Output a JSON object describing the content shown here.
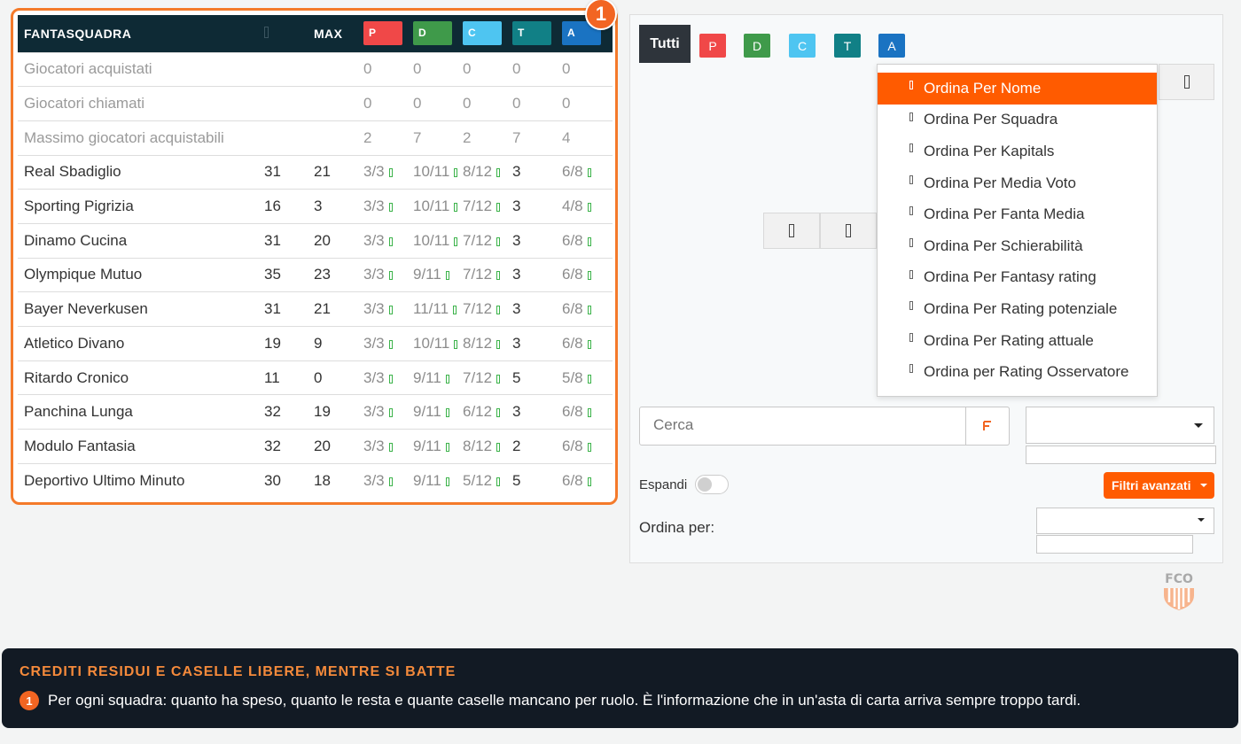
{
  "colors": {
    "accent": "#ff5b00",
    "p": "#f04848",
    "d": "#3f9a4a",
    "c": "#4ec5f1",
    "t": "#118086",
    "a": "#1a73c2",
    "ok": "#3cb34a"
  },
  "table": {
    "badge": "1",
    "headers": {
      "team": "FANTASQUADRA",
      "max": "MAX",
      "p": "P",
      "d": "D",
      "c": "C",
      "t": "T",
      "a": "A"
    },
    "summary": [
      {
        "label": "Giocatori acquistati",
        "p": "0",
        "d": "0",
        "c": "0",
        "t": "0",
        "a": "0"
      },
      {
        "label": "Giocatori chiamati",
        "p": "0",
        "d": "0",
        "c": "0",
        "t": "0",
        "a": "0"
      },
      {
        "label": "Massimo giocatori acquistabili",
        "p": "2",
        "d": "7",
        "c": "2",
        "t": "7",
        "a": "4"
      }
    ],
    "rows": [
      {
        "team": "Real Sbadiglio",
        "credits": "31",
        "max": "21",
        "p": "3/3",
        "d": "10/11",
        "c": "8/12",
        "t": "3",
        "a": "6/8"
      },
      {
        "team": "Sporting Pigrizia",
        "credits": "16",
        "max": "3",
        "p": "3/3",
        "d": "10/11",
        "c": "7/12",
        "t": "3",
        "a": "4/8"
      },
      {
        "team": "Dinamo Cucina",
        "credits": "31",
        "max": "20",
        "p": "3/3",
        "d": "10/11",
        "c": "7/12",
        "t": "3",
        "a": "6/8"
      },
      {
        "team": "Olympique Mutuo",
        "credits": "35",
        "max": "23",
        "p": "3/3",
        "d": "9/11",
        "c": "7/12",
        "t": "3",
        "a": "6/8"
      },
      {
        "team": "Bayer Neverkusen",
        "credits": "31",
        "max": "21",
        "p": "3/3",
        "d": "11/11",
        "c": "7/12",
        "t": "3",
        "a": "6/8"
      },
      {
        "team": "Atletico Divano",
        "credits": "19",
        "max": "9",
        "p": "3/3",
        "d": "10/11",
        "c": "8/12",
        "t": "3",
        "a": "6/8"
      },
      {
        "team": "Ritardo Cronico",
        "credits": "11",
        "max": "0",
        "p": "3/3",
        "d": "9/11",
        "c": "7/12",
        "t": "5",
        "a": "5/8"
      },
      {
        "team": "Panchina Lunga",
        "credits": "32",
        "max": "19",
        "p": "3/3",
        "d": "9/11",
        "c": "6/12",
        "t": "3",
        "a": "6/8"
      },
      {
        "team": "Modulo Fantasia",
        "credits": "32",
        "max": "20",
        "p": "3/3",
        "d": "9/11",
        "c": "8/12",
        "t": "2",
        "a": "6/8"
      },
      {
        "team": "Deportivo Ultimo Minuto",
        "credits": "30",
        "max": "18",
        "p": "3/3",
        "d": "9/11",
        "c": "5/12",
        "t": "5",
        "a": "6/8"
      }
    ]
  },
  "panel": {
    "tabs": [
      "Tutti",
      "P",
      "D",
      "C",
      "T",
      "A"
    ],
    "sort_options": [
      "Ordina Per Nome",
      "Ordina Per Squadra",
      "Ordina Per Kapitals",
      "Ordina Per Media Voto",
      "Ordina Per Fanta Media",
      "Ordina Per Schierabilità",
      "Ordina Per Fantasy rating",
      "Ordina Per Rating potenziale",
      "Ordina Per Rating attuale",
      "Ordina per Rating Osservatore"
    ],
    "search_placeholder": "Cerca",
    "expand_label": "Espandi",
    "advanced_filters": "Filtri avanzati",
    "sort_label": "Ordina per:",
    "logo_text": "FCO"
  },
  "tip": {
    "title": "CREDITI RESIDUI E CASELLE LIBERE, MENTRE SI BATTE",
    "num": "1",
    "text": "Per ogni squadra: quanto ha speso, quanto le resta e quante caselle mancano per ruolo. È l'informazione che in un'asta di carta arriva sempre troppo tardi."
  }
}
